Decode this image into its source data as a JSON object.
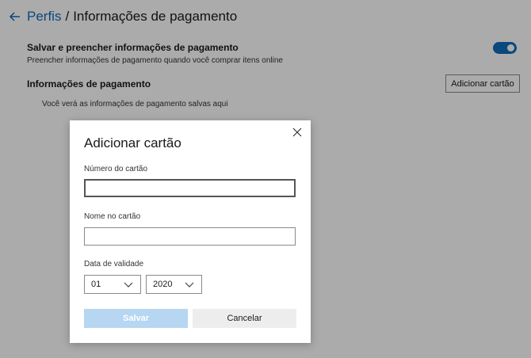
{
  "header": {
    "breadcrumb_link": "Perfis",
    "separator": "/",
    "current": "Informações de pagamento"
  },
  "settings": {
    "save_fill": {
      "title": "Salvar e preencher informações de pagamento",
      "description": "Preencher informações de pagamento quando você comprar itens online",
      "enabled": true
    },
    "payment_info": {
      "title": "Informações de pagamento",
      "add_card_label": "Adicionar cartão",
      "empty_text": "Você verá as informações de pagamento salvas aqui"
    }
  },
  "dialog": {
    "title": "Adicionar cartão",
    "card_number_label": "Número do cartão",
    "card_number_value": "",
    "name_label": "Nome no cartão",
    "name_value": "",
    "expiry_label": "Data de validade",
    "month": "01",
    "year": "2020",
    "save_label": "Salvar",
    "cancel_label": "Cancelar"
  },
  "colors": {
    "accent": "#0f6cbd",
    "save_disabled": "#b6d6f2",
    "cancel_bg": "#ededed",
    "overlay": "rgba(0,0,0,0.33)"
  }
}
